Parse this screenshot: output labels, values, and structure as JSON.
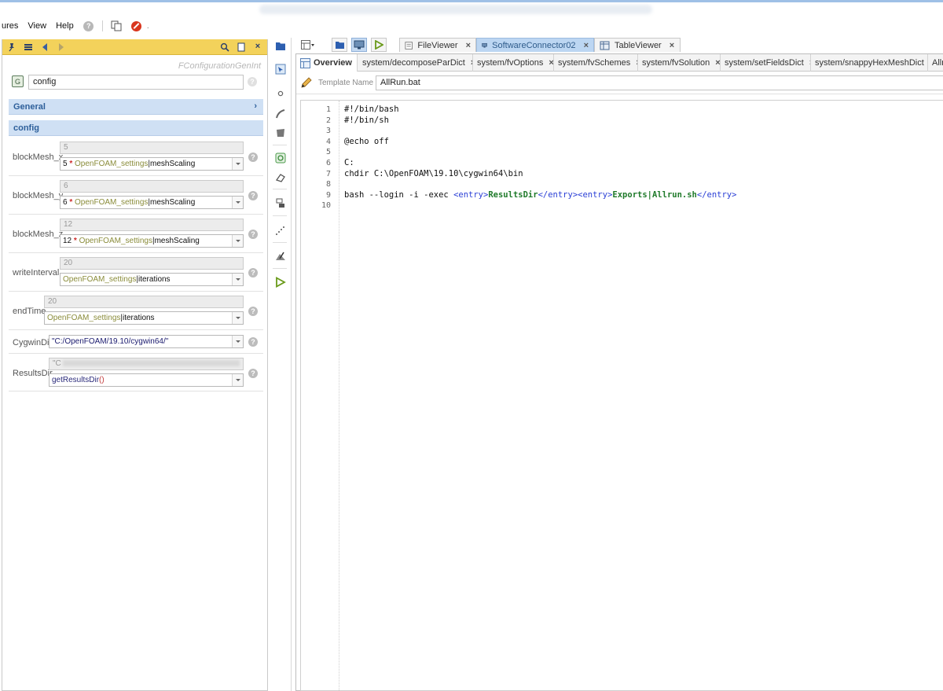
{
  "menu": {
    "items": [
      "ures",
      "View",
      "Help"
    ]
  },
  "left_panel": {
    "class_name": "FConfigurationGenInt",
    "config_name": "config",
    "sections": {
      "general": "General",
      "config": "config"
    },
    "properties": [
      {
        "label": "blockMesh_x",
        "value": "5",
        "expr": {
          "num": "5",
          "op": "*",
          "ref": "OpenFOAM_settings",
          "attr": "meshScaling"
        }
      },
      {
        "label": "blockMesh_y",
        "value": "6",
        "expr": {
          "num": "6",
          "op": "*",
          "ref": "OpenFOAM_settings",
          "attr": "meshScaling"
        }
      },
      {
        "label": "blockMesh_z",
        "value": "12",
        "expr": {
          "num": "12",
          "op": "*",
          "ref": "OpenFOAM_settings",
          "attr": "meshScaling"
        }
      },
      {
        "label": "writeInterval",
        "value": "20",
        "expr": {
          "ref": "OpenFOAM_settings",
          "attr": "iterations"
        }
      },
      {
        "label": "endTime",
        "value": "20",
        "expr": {
          "ref": "OpenFOAM_settings",
          "attr": "iterations"
        }
      }
    ],
    "cygwin": {
      "label": "CygwinDir",
      "expr": "\"C:/OpenFOAM/19.10/cygwin64/\""
    },
    "results": {
      "label": "ResultsDir",
      "value_prefix": "\"C",
      "fn": "getResultsDir",
      "paren": "()"
    }
  },
  "top_tabs": [
    {
      "label": "FileViewer",
      "active": false
    },
    {
      "label": "SoftwareConnector02",
      "active": true
    },
    {
      "label": "TableViewer",
      "active": false
    }
  ],
  "editor": {
    "tabs": [
      {
        "label": "Overview",
        "active": true
      },
      {
        "label": "system/decomposeParDict"
      },
      {
        "label": "system/fvOptions"
      },
      {
        "label": "system/fvSchemes"
      },
      {
        "label": "system/fvSolution"
      },
      {
        "label": "system/setFieldsDict"
      },
      {
        "label": "system/snappyHexMeshDict"
      },
      {
        "label": "Allr"
      }
    ],
    "template_label": "Template Name",
    "template_name": "AllRun.bat",
    "line_numbers": [
      "1",
      "2",
      "3",
      "4",
      "5",
      "6",
      "7",
      "8",
      "9",
      "10"
    ],
    "lines": {
      "l1": "#!/bin/bash",
      "l2": "#!/bin/sh",
      "l3": "",
      "l4": "@echo off",
      "l5": "",
      "l6": "C:",
      "l7": "chdir C:\\OpenFOAM\\19.10\\cygwin64\\bin",
      "l8": "",
      "l9_prefix": "bash --login -i -exec ",
      "l9_tag_open1": "<entry>",
      "l9_val1": "ResultsDir",
      "l9_tag_close1": "</entry>",
      "l9_tag_open2": "<entry>",
      "l9_val2": "Exports|Allrun.sh",
      "l9_tag_close2": "</entry>",
      "l10": ""
    }
  },
  "colors": {
    "panel_toolbar": "#f3d25b",
    "section_bg": "#cfe0f4",
    "active_tab": "#bcd6f2",
    "xml_tag": "#2a3fd6",
    "xml_value": "#1f7a2a"
  }
}
